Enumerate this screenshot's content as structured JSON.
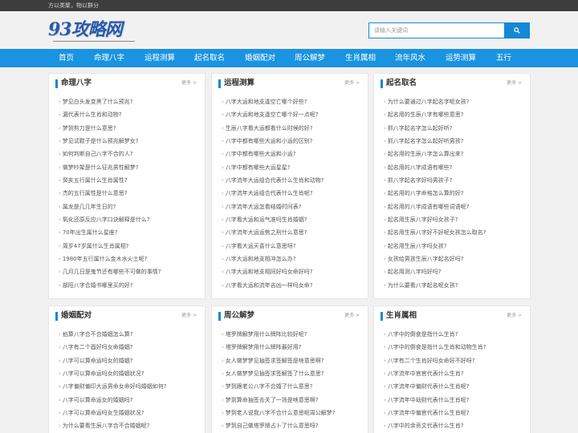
{
  "topbar": {
    "slogan": "方以类聚，物以群分"
  },
  "logo": {
    "text": "93攻略网"
  },
  "search": {
    "placeholder": "请输入关键词"
  },
  "nav": [
    "首页",
    "命理八字",
    "运程测算",
    "起名取名",
    "婚姻配对",
    "周公解梦",
    "生肖属相",
    "流年风水",
    "运势测算",
    "五行"
  ],
  "more_label": "更多 >",
  "panels": [
    {
      "title": "命理八字",
      "items": [
        "梦见白头发变黑了什么预兆?",
        "漏代表什么生肖和动物?",
        "梦到剪刀是什么意思?",
        "梦见试鞋子是什么预兆解梦女?",
        "如何判断自己八字不合的人?",
        "做梦吵架是什么征兆男性解梦?",
        "癸亥五行属什么生肖属性?",
        "杰的五行属性是什么意思?",
        "属龙是几几年生日的?",
        "氧化还原反应八字口诀解释是什么?",
        "70年出生属什么星座?",
        "周岁47岁属什么生肖属相?",
        "1980年五行属什么金木水火土呢?",
        "几月几日是鬼节还有哪些不可做的事情?",
        "部阳八字合婚书哪里买的好?"
      ]
    },
    {
      "title": "运程测算",
      "items": [
        "八字大运和地支逢空亡哪个好些?",
        "八字大运和地支逢空亡哪个好一点呢?",
        "生辰八字看大运都看什么时候的好?",
        "八字中都有哪些大运和小运的区别?",
        "八字中都有哪些大运和小运?",
        "八字中都有哪些大运星星?",
        "八字流年大运组合代表什么生肖和动物?",
        "八字流年大运组合代表什么生肖呢?",
        "八字流年大运怎看结婚时间表?",
        "八字看大运和运气准吗生肖婚姻?",
        "八字流年大运运势之刑什么意思?",
        "八字看大运天喜什么意思呀?",
        "八字大运和地支相冲怎么办?",
        "八字大运和地支相同好吗女命好吗?",
        "八字看大运和流年吉凶一样吗女命?"
      ]
    },
    {
      "title": "起名取名",
      "items": [
        "为什么要通过八字起名字呢女孩?",
        "起名用的生辰八字有哪些意思?",
        "抓八字起名字怎么起好听?",
        "抓八字起名字怎么起好听男孩?",
        "起名用的生辰八字怎么算出来?",
        "起名用的八字成语有哪些?",
        "抓八字起名字好吗男孩子?",
        "起名用的八字命格怎么算的好?",
        "起名用的八字成语有哪些词语呢?",
        "起名用生辰八字好吗女孩子?",
        "起名用生辰八字好不好呢女孩怎么取名?",
        "起名用生辰八字吗女孩?",
        "女孩给男孩生辰八字起名好吗?",
        "起名用测八字吗好吗?",
        "为什么要看八字起名呢女孩?"
      ]
    },
    {
      "title": "婚姻配对",
      "items": [
        "掐算八字合不合婚姻怎么算?",
        "八字有二个酉好吗女命婚姻?",
        "八字可以算命运吗女的婚姻?",
        "八字可以算命运吗女的婚姻状况?",
        "八字偏财偏印大运男命女命好吗婚姻如何?",
        "八字可以算命运女的婚姻吗?",
        "八字可以算命运吗女生婚姻状况?",
        "为什么要看生辰八字合不合婚姻呢?"
      ]
    },
    {
      "title": "周公解梦",
      "items": [
        "塔罗牌解梦用什么牌阵比较好呢?",
        "塔罗牌解梦用什么牌阵最好用?",
        "女人做梦梦见抽签求签解签是啥意思啊?",
        "女人做梦梦见抽签求签解签了什么意思?",
        "梦到跟老公八字不合婚了什么意思?",
        "梦到算命抽签去关了一场是啥意思啊?",
        "梦到老人说我八字不合什么意思呢周公解梦?",
        "梦到自己做塔罗牌占卜了什么意思呀?"
      ]
    },
    {
      "title": "生肖属相",
      "items": [
        "八字中的倒食是指什么生肖?",
        "八字中的倒食是指什么生肖和动物生肖?",
        "八字有二个生肖好吗女命好不好呀?",
        "八字流年中官官代表什么生肖?",
        "八字流年中偏财代表什么生肖呢?",
        "八字流年中劫财代表什么生肖呢?",
        "八字流年中偏官代表什么生肖呢?",
        "八字中的余贡文代表什么生肖?"
      ]
    }
  ]
}
